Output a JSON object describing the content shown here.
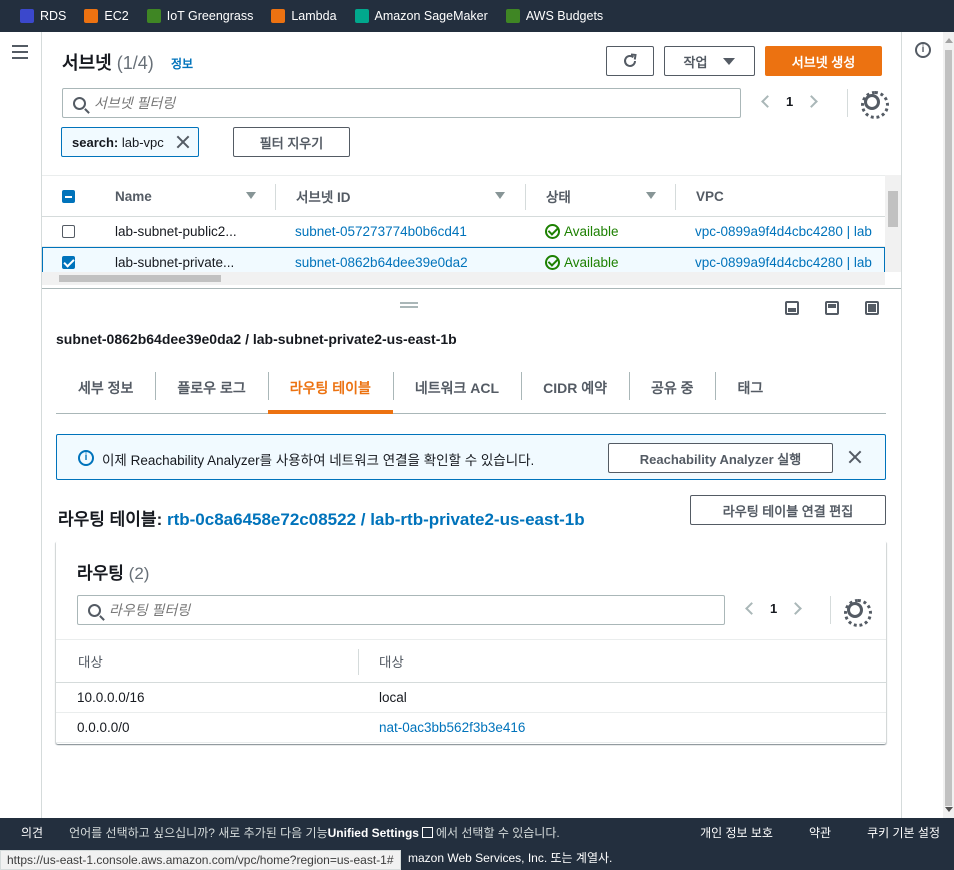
{
  "favorites": [
    {
      "label": "RDS",
      "icon": "rds-icon",
      "color": "#3b48cc"
    },
    {
      "label": "EC2",
      "icon": "ec2-icon",
      "color": "#ec7211"
    },
    {
      "label": "IoT Greengrass",
      "icon": "greengrass-icon",
      "color": "#3f8624"
    },
    {
      "label": "Lambda",
      "icon": "lambda-icon",
      "color": "#ec7211"
    },
    {
      "label": "Amazon SageMaker",
      "icon": "sagemaker-icon",
      "color": "#01a88d"
    },
    {
      "label": "AWS Budgets",
      "icon": "budgets-icon",
      "color": "#3f8624"
    }
  ],
  "header": {
    "title": "서브넷",
    "count": "(1/4)",
    "info": "정보",
    "actions_label": "작업",
    "create_label": "서브넷 생성"
  },
  "search": {
    "placeholder": "서브넷 필터링",
    "page": "1",
    "token_key": "search:",
    "token_value": "lab-vpc",
    "clear_label": "필터 지우기"
  },
  "table": {
    "columns": [
      "Name",
      "서브넷 ID",
      "상태",
      "VPC"
    ],
    "rows": [
      {
        "name": "lab-subnet-public2...",
        "subnet_id": "subnet-057273774b0b6cd41",
        "state": "Available",
        "vpc": "vpc-0899a9f4d4cbc4280 | lab",
        "checked": false
      },
      {
        "name": "lab-subnet-private...",
        "subnet_id": "subnet-0862b64dee39e0da2",
        "state": "Available",
        "vpc": "vpc-0899a9f4d4cbc4280 | lab",
        "checked": true
      }
    ]
  },
  "detail": {
    "title": "subnet-0862b64dee39e0da2 / lab-subnet-private2-us-east-1b",
    "tabs": [
      "세부 정보",
      "플로우 로그",
      "라우팅 테이블",
      "네트워크 ACL",
      "CIDR 예약",
      "공유 중",
      "태그"
    ],
    "active_tab": "라우팅 테이블",
    "alert_text": "이제 Reachability Analyzer를 사용하여 네트워크 연결을 확인할 수 있습니다.",
    "alert_button": "Reachability Analyzer 실행",
    "rtb_prefix": "라우팅 테이블:",
    "rtb_link": "rtb-0c8a6458e72c08522 / lab-rtb-private2-us-east-1b",
    "rtb_edit_button": "라우팅 테이블 연결 편집",
    "routes_title": "라우팅",
    "routes_count": "(2)",
    "routes_placeholder": "라우팅 필터링",
    "routes_page": "1",
    "routes_columns": [
      "대상",
      "대상"
    ],
    "routes": [
      {
        "destination": "10.0.0.0/16",
        "target": "local",
        "target_is_link": false
      },
      {
        "destination": "0.0.0.0/0",
        "target": "nat-0ac3bb562f3b3e416",
        "target_is_link": true
      }
    ]
  },
  "footer": {
    "feedback": "의견",
    "lang_prefix": "언어를 선택하고 싶으십니까? 새로 추가된 다음 기능",
    "lang_link": "Unified Settings",
    "lang_suffix": "에서 선택할 수 있습니다.",
    "privacy": "개인 정보 보호",
    "terms": "약관",
    "cookies": "쿠키 기본 설정",
    "copyright": "mazon Web Services, Inc. 또는 계열사."
  },
  "status_url": "https://us-east-1.console.aws.amazon.com/vpc/home?region=us-east-1#"
}
